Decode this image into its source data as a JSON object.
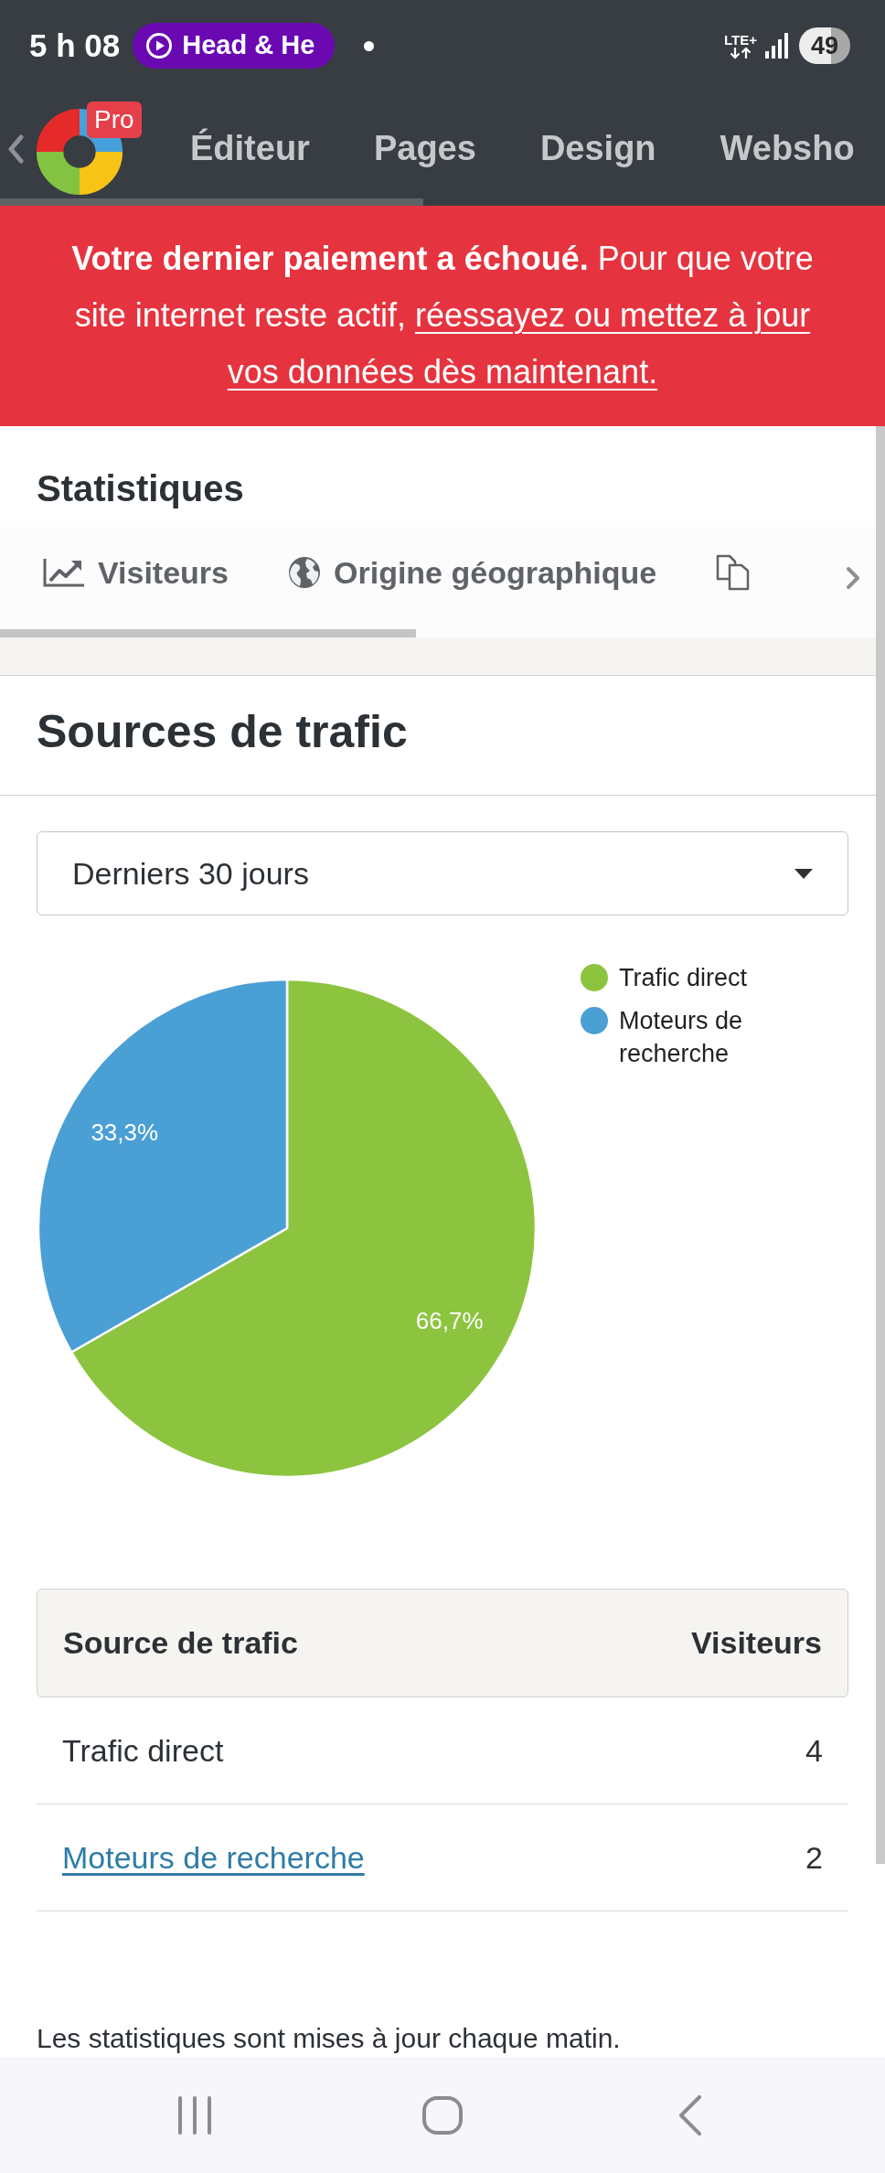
{
  "status_bar": {
    "time": "5 h 08",
    "media_chip": "Head & He",
    "network": "LTE+",
    "battery": "49"
  },
  "app_nav": {
    "badge": "Pro",
    "items": [
      "Éditeur",
      "Pages",
      "Design",
      "Websho"
    ]
  },
  "banner": {
    "message": "**Votre dernier paiement a échoué.** Pour que votre site internet reste actif,",
    "link_lines": [
      "réessayez ou mettez à jour",
      "vos données dès maintenant."
    ]
  },
  "statistics": {
    "title": "Statistiques",
    "tabs": [
      {
        "label": "Visiteurs"
      },
      {
        "label": "Origine géographique"
      }
    ],
    "partial_tab": true
  },
  "traffic_sources": {
    "title": "Sources de trafic",
    "period_select": {
      "value": "Derniers 30 jours"
    },
    "chart_data": {
      "type": "pie",
      "categories": [
        "Trafic direct",
        "Moteurs de recherche"
      ],
      "values": [
        66.7,
        33.3
      ],
      "colors": [
        "#8cc43f",
        "#4a9fd5"
      ],
      "value_labels": [
        "66,7%",
        "33,3%"
      ],
      "legend": "right"
    },
    "table": {
      "columns": [
        "Source de trafic",
        "Visiteurs"
      ],
      "rows": [
        {
          "source": "Trafic direct",
          "visitors": "4",
          "link": false
        },
        {
          "source": "Moteurs de recherche",
          "visitors": "2",
          "link": true
        }
      ]
    }
  },
  "footnote": "Les statistiques sont mises à jour chaque matin."
}
